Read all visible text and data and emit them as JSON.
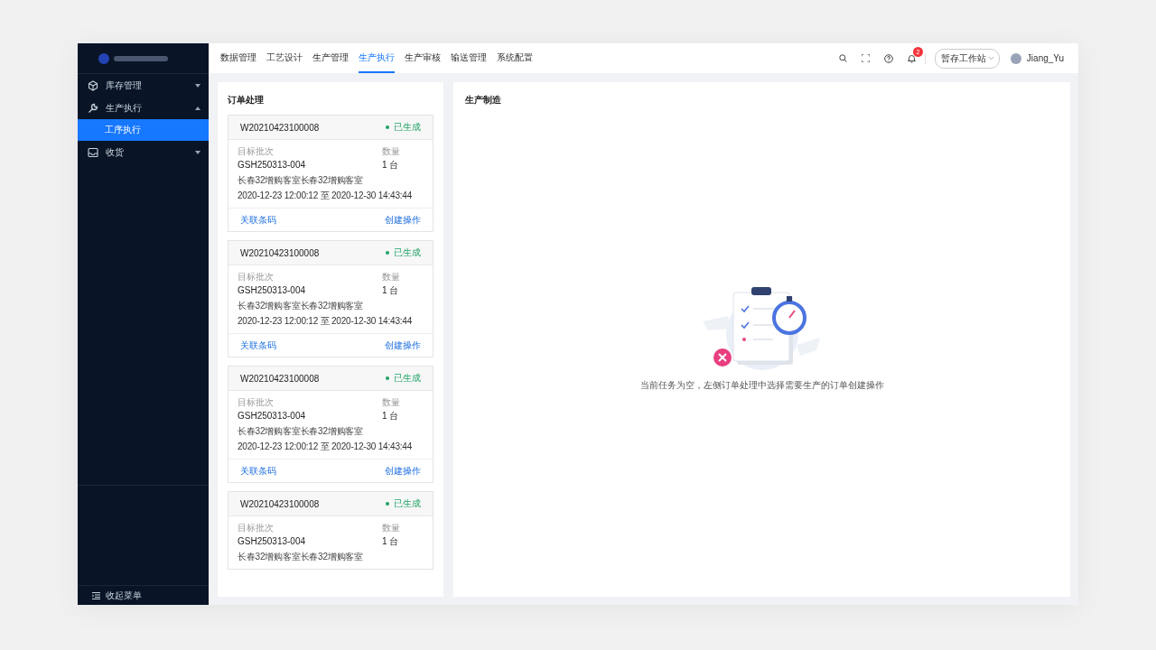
{
  "sidebar": {
    "items": [
      {
        "label": "库存管理",
        "expanded": false
      },
      {
        "label": "生产执行",
        "expanded": true,
        "children": [
          {
            "label": "工序执行",
            "selected": true
          }
        ]
      },
      {
        "label": "收货",
        "expanded": false
      }
    ],
    "collapse_label": "收起菜单"
  },
  "top_nav": {
    "tabs": [
      {
        "label": "数据管理",
        "selected": false
      },
      {
        "label": "工艺设计",
        "selected": false
      },
      {
        "label": "生产管理",
        "selected": false
      },
      {
        "label": "生产执行",
        "selected": true
      },
      {
        "label": "生产审核",
        "selected": false
      },
      {
        "label": "输送管理",
        "selected": false
      },
      {
        "label": "系统配置",
        "selected": false
      }
    ],
    "notification_count": "2",
    "workstation_button": "暂存工作站",
    "user_name": "Jiang_Yu"
  },
  "order_panel": {
    "title": "订单处理",
    "orders": [
      {
        "order_no": "W20210423100008",
        "status": "已生成",
        "batch_label": "目标批次",
        "batch": "GSH250313-004",
        "quantity_label": "数量",
        "quantity": "1",
        "unit": "台",
        "location": "长春32增购客室长春32增购客室",
        "period": "2020-12-23 12:00:12 至 2020-12-30 14:43:44",
        "link_barcode": "关联条码",
        "link_create": "创建操作"
      },
      {
        "order_no": "W20210423100008",
        "status": "已生成",
        "batch_label": "目标批次",
        "batch": "GSH250313-004",
        "quantity_label": "数量",
        "quantity": "1",
        "unit": "台",
        "location": "长春32增购客室长春32增购客室",
        "period": "2020-12-23 12:00:12 至 2020-12-30 14:43:44",
        "link_barcode": "关联条码",
        "link_create": "创建操作"
      },
      {
        "order_no": "W20210423100008",
        "status": "已生成",
        "batch_label": "目标批次",
        "batch": "GSH250313-004",
        "quantity_label": "数量",
        "quantity": "1",
        "unit": "台",
        "location": "长春32增购客室长春32增购客室",
        "period": "2020-12-23 12:00:12 至 2020-12-30 14:43:44",
        "link_barcode": "关联条码",
        "link_create": "创建操作"
      },
      {
        "order_no": "W20210423100008",
        "status": "已生成",
        "batch_label": "目标批次",
        "batch": "GSH250313-004",
        "quantity_label": "数量",
        "quantity": "1",
        "unit": "台",
        "location": "长春32增购客室长春32增购客室"
      }
    ]
  },
  "production_panel": {
    "title": "生产制造",
    "empty_message": "当前任务为空，左侧订单处理中选择需要生产的订单创建操作"
  }
}
